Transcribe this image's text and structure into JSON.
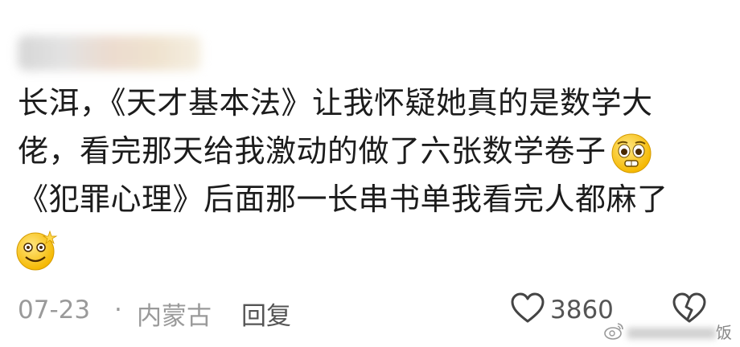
{
  "comment": {
    "lines": [
      "长洱，《天才基本法》让我怀疑她真的是数学大",
      "佬，看完那天给我激动的做了六张数学卷子",
      "《犯罪心理》后面那一长串书单我看完人都麻了"
    ],
    "emoji_1": "pleading-face-emoji",
    "emoji_2": "dizzy-smile-emoji"
  },
  "footer": {
    "date": "07-23",
    "separator": "·",
    "location": "内蒙古",
    "reply_label": "回复",
    "like_count": "3860",
    "like_icon": "heart-icon",
    "dislike_icon": "broken-heart-icon"
  },
  "watermark": {
    "char": "饭",
    "icon": "weibo-logo"
  }
}
